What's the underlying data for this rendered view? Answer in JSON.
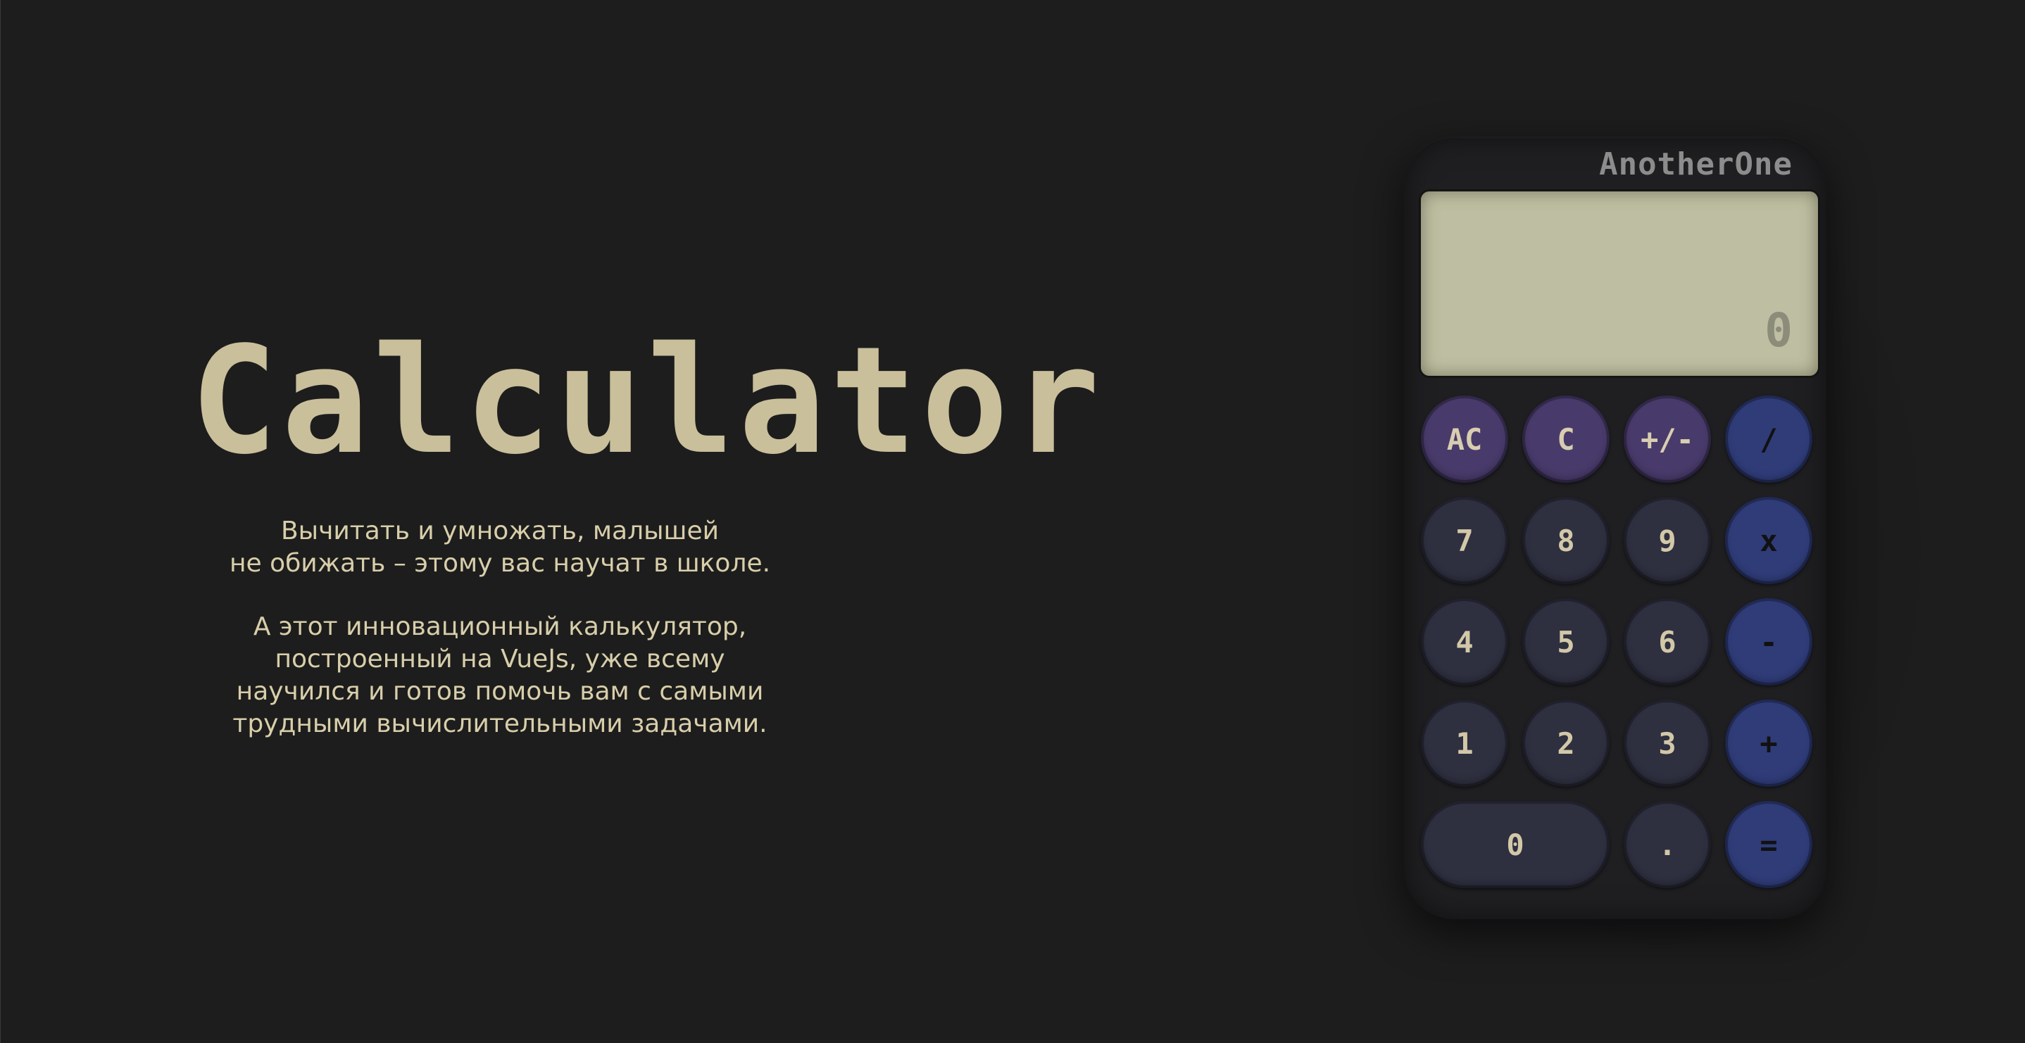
{
  "intro": {
    "title": "Calculator",
    "paragraphs": [
      "Вычитать и умножать, малышей\nне обижать – этому вас научат в школе.",
      "А этот инновационный калькулятор,\nпостроенный на VueJs, уже всему\nнаучился и готов помочь вам с самыми\nтрудными вычислительными задачами."
    ]
  },
  "calculator": {
    "brand": "AnotherOne",
    "display_value": "0",
    "keys": [
      {
        "label": "AC",
        "kind": "func",
        "name": "all-clear-button"
      },
      {
        "label": "C",
        "kind": "func",
        "name": "clear-button"
      },
      {
        "label": "+/-",
        "kind": "func",
        "name": "toggle-sign-button"
      },
      {
        "label": "/",
        "kind": "op",
        "name": "divide-button"
      },
      {
        "label": "7",
        "kind": "num",
        "name": "digit-7-button"
      },
      {
        "label": "8",
        "kind": "num",
        "name": "digit-8-button"
      },
      {
        "label": "9",
        "kind": "num",
        "name": "digit-9-button"
      },
      {
        "label": "x",
        "kind": "op",
        "name": "multiply-button"
      },
      {
        "label": "4",
        "kind": "num",
        "name": "digit-4-button"
      },
      {
        "label": "5",
        "kind": "num",
        "name": "digit-5-button"
      },
      {
        "label": "6",
        "kind": "num",
        "name": "digit-6-button"
      },
      {
        "label": "-",
        "kind": "op",
        "name": "subtract-button"
      },
      {
        "label": "1",
        "kind": "num",
        "name": "digit-1-button"
      },
      {
        "label": "2",
        "kind": "num",
        "name": "digit-2-button"
      },
      {
        "label": "3",
        "kind": "num",
        "name": "digit-3-button"
      },
      {
        "label": "+",
        "kind": "op",
        "name": "add-button"
      },
      {
        "label": "0",
        "kind": "num",
        "name": "digit-0-button"
      },
      {
        "label": ".",
        "kind": "num",
        "name": "decimal-point-button"
      },
      {
        "label": "=",
        "kind": "op",
        "name": "equals-button"
      }
    ]
  },
  "colors": {
    "page_background": "#1d1d1d",
    "title_color": "#c9bf9b",
    "display_background": "#bebea2",
    "number_key": "#2e2f3f",
    "function_key": "#483a6a",
    "operator_key": "#2f3c78"
  }
}
